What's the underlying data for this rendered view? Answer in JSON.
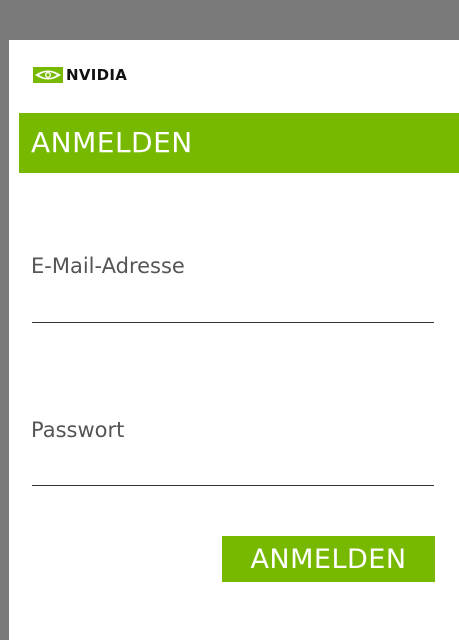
{
  "brand": {
    "logo_text": "NVIDIA",
    "logo_icon": "nvidia-eye-icon",
    "accent_color": "#76b900"
  },
  "header": {
    "title": "ANMELDEN"
  },
  "form": {
    "email_label": "E-Mail-Adresse",
    "email_value": "",
    "password_label": "Passwort",
    "password_value": "",
    "submit_label": "ANMELDEN"
  }
}
